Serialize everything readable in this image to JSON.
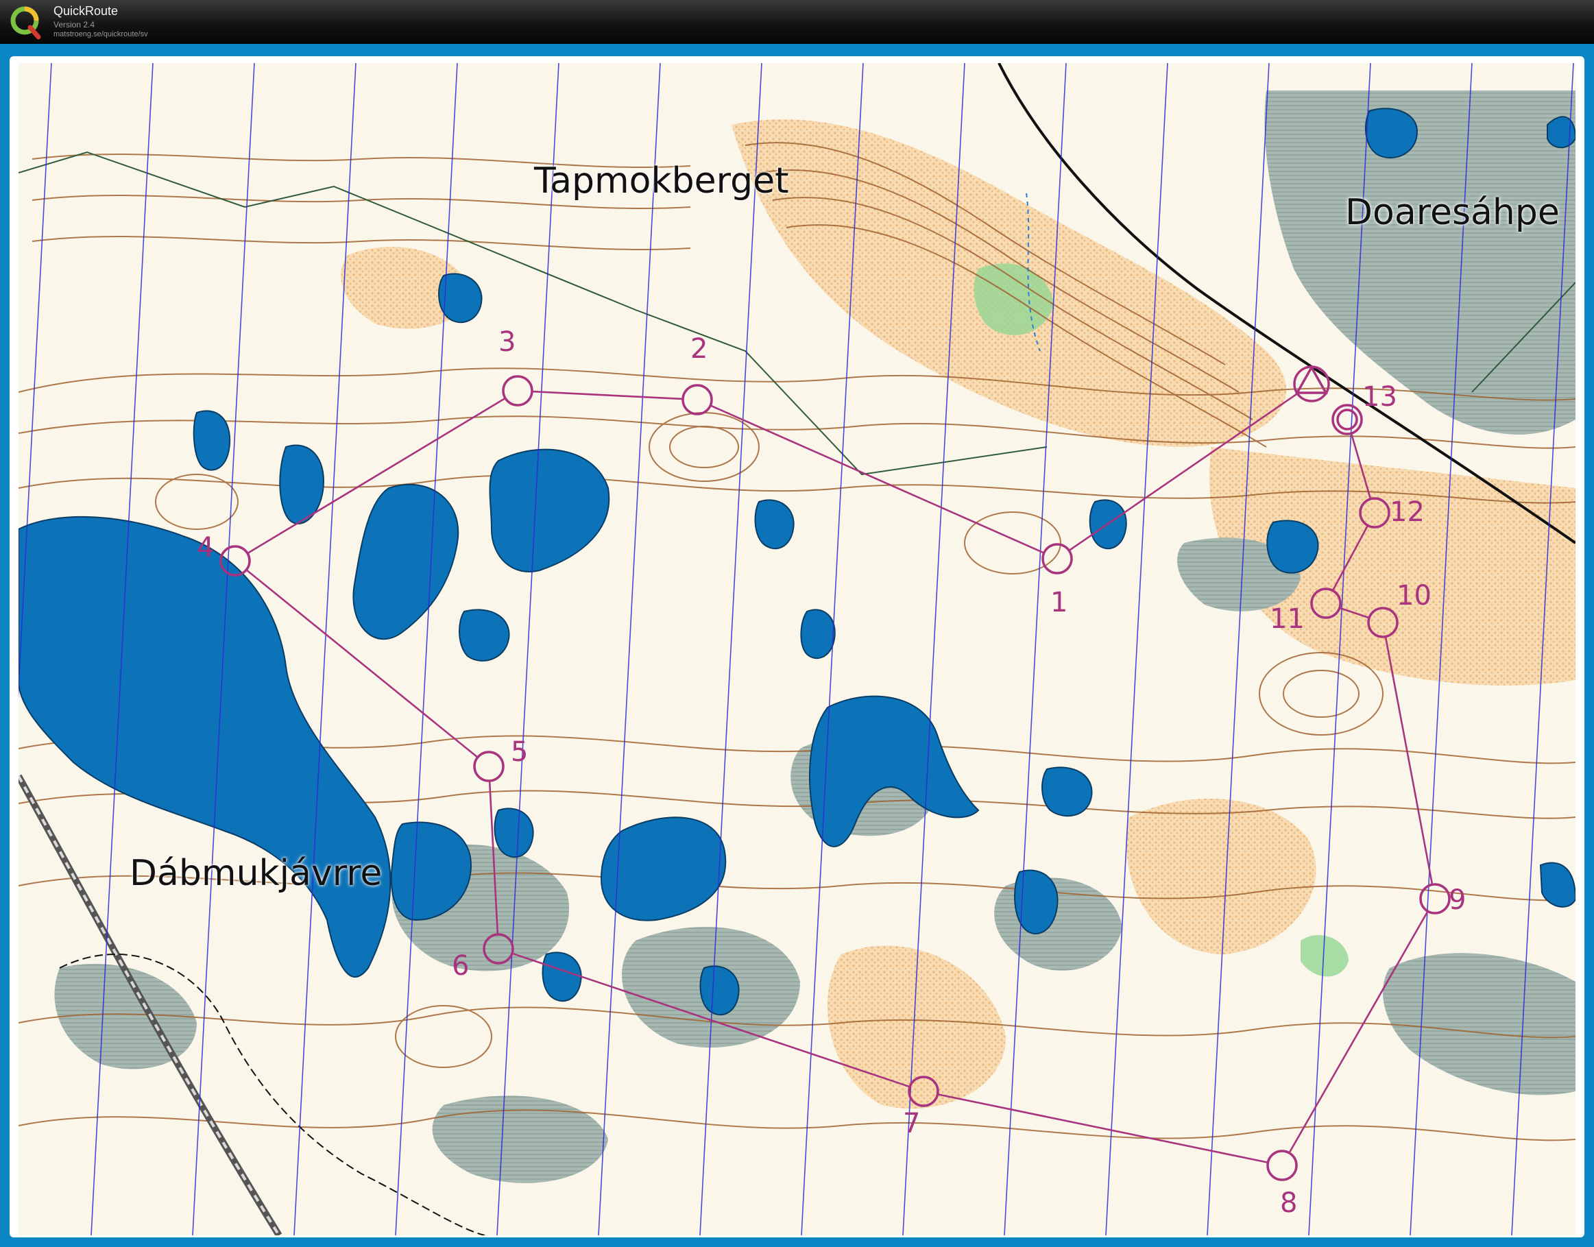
{
  "app": {
    "title": "QuickRoute",
    "version": "Version 2.4",
    "url": "matstroeng.se/quickroute/sv"
  },
  "colors": {
    "frame": "#0a86c4",
    "course": "#a8347f",
    "water": "#0d73b8",
    "marsh": "#9fb3ad",
    "open_land": "#f4cf9b",
    "contour": "#9a5a2a",
    "magnetic_north": "#2b2bd6",
    "vegetation": "#8fd48f"
  },
  "places": {
    "tapmokberget": "Tapmokberget",
    "doaresahpe": "Doaresáhpe",
    "dabmukjavrre": "Dábmukjávrre"
  },
  "course": {
    "start_symbol": "triangle-icon",
    "finish_symbol": "double-circle-icon",
    "controls": [
      {
        "label": "1"
      },
      {
        "label": "2"
      },
      {
        "label": "3"
      },
      {
        "label": "4"
      },
      {
        "label": "5"
      },
      {
        "label": "6"
      },
      {
        "label": "7"
      },
      {
        "label": "8"
      },
      {
        "label": "9"
      },
      {
        "label": "10"
      },
      {
        "label": "11"
      },
      {
        "label": "12"
      },
      {
        "label": "13"
      }
    ]
  }
}
